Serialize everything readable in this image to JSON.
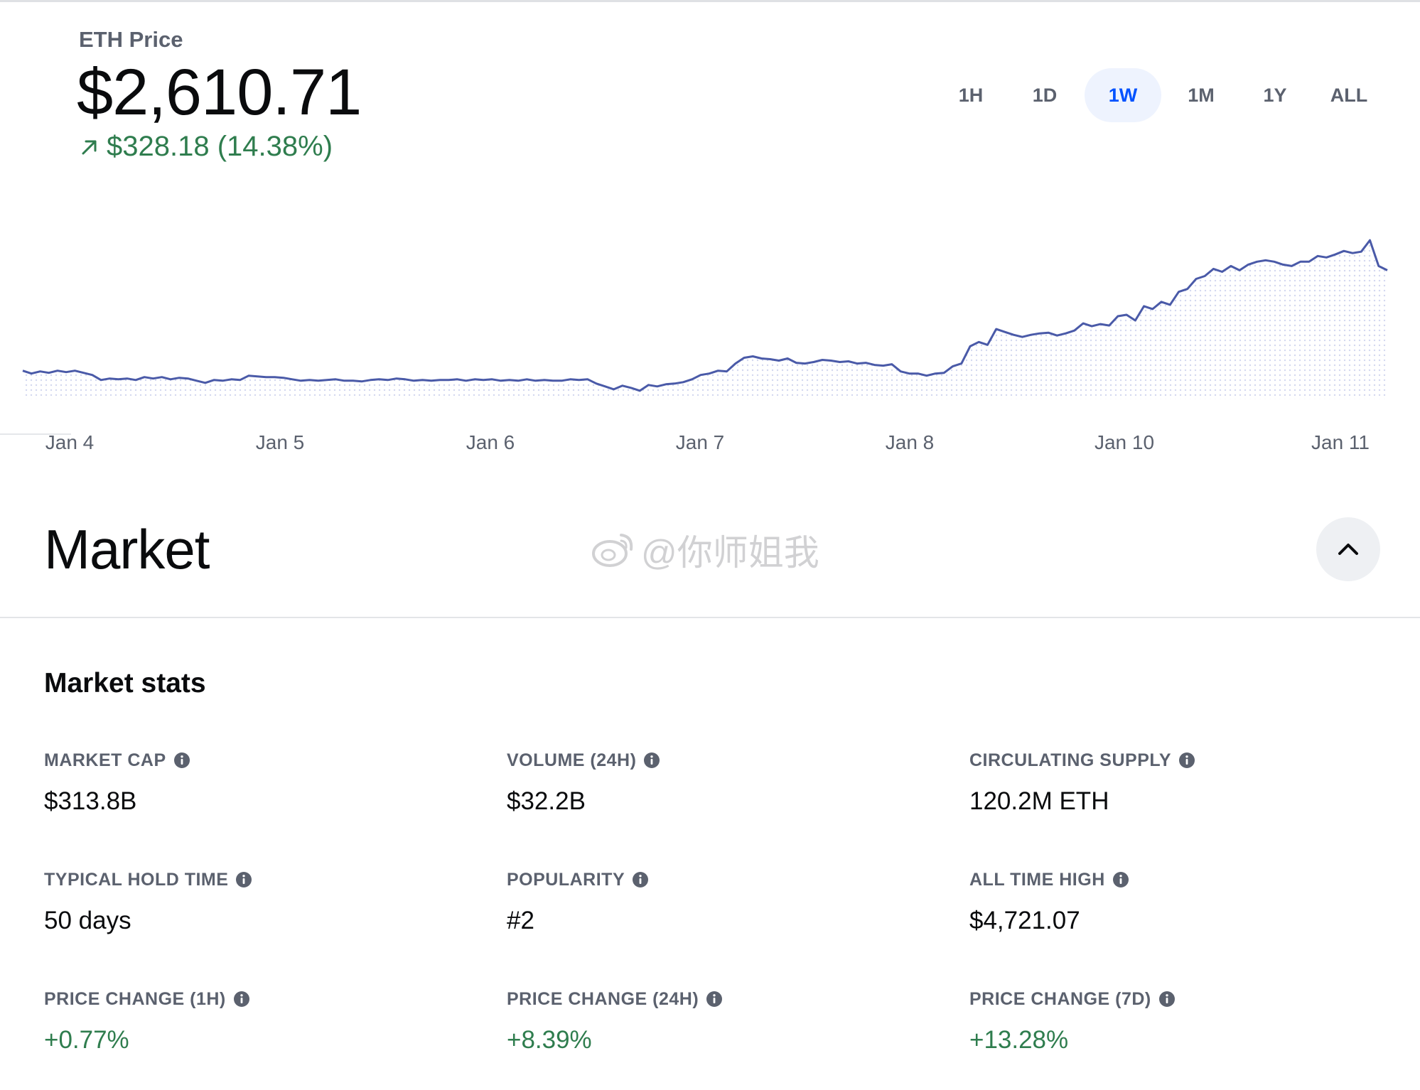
{
  "header": {
    "asset_label": "ETH Price",
    "price": "$2,610.71",
    "change_text": "$328.18 (14.38%)",
    "change_color": "#2f7d4e"
  },
  "time_ranges": {
    "selected": "1W",
    "options": [
      "1H",
      "1D",
      "1W",
      "1M",
      "1Y",
      "ALL"
    ]
  },
  "chart_data": {
    "type": "line",
    "x_labels": [
      "Jan 4",
      "Jan 5",
      "Jan 6",
      "Jan 7",
      "Jan 8",
      "Jan 10",
      "Jan 11"
    ],
    "series": [
      {
        "color": "#4a5aa8",
        "values": [
          2290,
          2286,
          2289,
          2287,
          2290,
          2288,
          2290,
          2287,
          2284,
          2277,
          2279,
          2278,
          2279,
          2277,
          2281,
          2279,
          2281,
          2278,
          2280,
          2279,
          2276,
          2273,
          2277,
          2276,
          2278,
          2277,
          2283,
          2282,
          2281,
          2281,
          2280,
          2278,
          2276,
          2277,
          2276,
          2277,
          2278,
          2276,
          2276,
          2275,
          2277,
          2278,
          2277,
          2279,
          2278,
          2276,
          2277,
          2276,
          2277,
          2277,
          2278,
          2276,
          2278,
          2277,
          2278,
          2276,
          2277,
          2276,
          2278,
          2276,
          2277,
          2276,
          2276,
          2278,
          2277,
          2278,
          2272,
          2268,
          2264,
          2269,
          2266,
          2262,
          2270,
          2268,
          2271,
          2272,
          2274,
          2278,
          2284,
          2286,
          2290,
          2289,
          2300,
          2308,
          2310,
          2307,
          2306,
          2304,
          2307,
          2301,
          2300,
          2302,
          2305,
          2304,
          2302,
          2303,
          2300,
          2301,
          2298,
          2297,
          2299,
          2289,
          2286,
          2286,
          2283,
          2286,
          2287,
          2296,
          2300,
          2324,
          2330,
          2326,
          2348,
          2344,
          2340,
          2337,
          2340,
          2342,
          2343,
          2339,
          2342,
          2346,
          2356,
          2352,
          2355,
          2353,
          2366,
          2368,
          2360,
          2380,
          2376,
          2386,
          2382,
          2400,
          2404,
          2418,
          2422,
          2432,
          2428,
          2436,
          2430,
          2438,
          2442,
          2444,
          2442,
          2438,
          2436,
          2442,
          2442,
          2450,
          2448,
          2452,
          2457,
          2454,
          2456,
          2472,
          2436,
          2430
        ]
      }
    ],
    "grid": false,
    "fill": "dotted-area"
  },
  "market": {
    "title": "Market",
    "collapse_icon": "chevron-up-icon",
    "watermark": "@你师姐我",
    "stats_title": "Market stats"
  },
  "stats": [
    {
      "label": "MARKET CAP",
      "value": "$313.8B",
      "positive": false
    },
    {
      "label": "VOLUME (24H)",
      "value": "$32.2B",
      "positive": false
    },
    {
      "label": "CIRCULATING SUPPLY",
      "value": "120.2M ETH",
      "positive": false
    },
    {
      "label": "TYPICAL HOLD TIME",
      "value": "50 days",
      "positive": false
    },
    {
      "label": "POPULARITY",
      "value": "#2",
      "positive": false
    },
    {
      "label": "ALL TIME HIGH",
      "value": "$4,721.07",
      "positive": false
    },
    {
      "label": "PRICE CHANGE (1H)",
      "value": "+0.77%",
      "positive": true
    },
    {
      "label": "PRICE CHANGE (24H)",
      "value": "+8.39%",
      "positive": true
    },
    {
      "label": "PRICE CHANGE (7D)",
      "value": "+13.28%",
      "positive": true
    }
  ],
  "colors": {
    "accent": "#0052ff",
    "positive": "#2f7d4e",
    "muted": "#5b616e",
    "chart_line": "#4a5aa8"
  }
}
